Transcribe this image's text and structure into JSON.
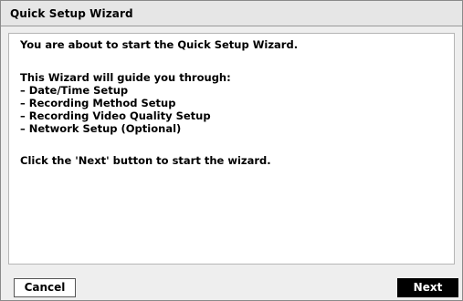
{
  "dialog": {
    "title": "Quick Setup Wizard"
  },
  "content": {
    "intro": "You are about to start the Quick Setup Wizard.",
    "guide_heading": "This Wizard will guide you through:",
    "steps": [
      "– Date/Time Setup",
      "– Recording Method Setup",
      "– Recording Video Quality Setup",
      "– Network Setup (Optional)"
    ],
    "instruction": "Click the 'Next' button to start the wizard."
  },
  "footer": {
    "cancel_label": "Cancel",
    "next_label": "Next"
  },
  "colors": {
    "next_button_bg": "#000000",
    "next_button_text": "#ffffff",
    "dialog_bg": "#eeeeee",
    "content_bg": "#ffffff"
  }
}
